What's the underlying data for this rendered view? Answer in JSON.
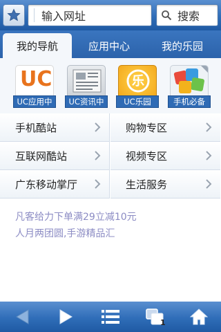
{
  "address_bar": {
    "url_placeholder": "输入网址",
    "search_label": "搜索"
  },
  "tabs": [
    {
      "label": "我的导航",
      "active": true
    },
    {
      "label": "应用中心",
      "active": false
    },
    {
      "label": "我的乐园",
      "active": false
    }
  ],
  "apps": [
    {
      "label": "UC应用中",
      "icon": "uc-logo-icon",
      "icon_text": "UC"
    },
    {
      "label": "UC资讯中",
      "icon": "news-icon"
    },
    {
      "label": "UC乐园",
      "icon": "uc-park-icon",
      "icon_text": "乐"
    },
    {
      "label": "手机必备",
      "icon": "app-bundle-icon"
    }
  ],
  "links": [
    {
      "label": "手机酷站"
    },
    {
      "label": "购物专区"
    },
    {
      "label": "互联网酷站"
    },
    {
      "label": "视频专区"
    },
    {
      "label": "广东移动掌厅"
    },
    {
      "label": "生活服务"
    }
  ],
  "promos": [
    "凡客给力下单满29立减10元",
    "人月两团圆,手游精品汇"
  ],
  "toolbar": {
    "page_count": "1"
  },
  "colors": {
    "bar_blue": "#2f6db8",
    "label_blue": "#2f6bb5",
    "promo_text": "#8c8cc4",
    "uc_orange": "#e8731d"
  }
}
